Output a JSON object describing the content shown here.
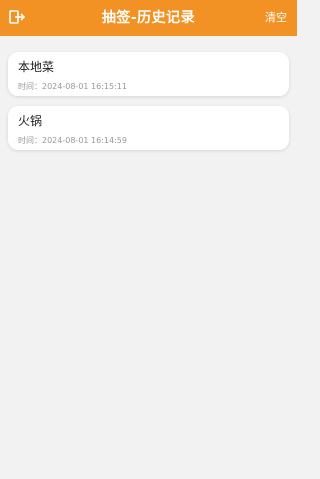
{
  "colors": {
    "accent": "#f39224",
    "background": "#f2f2f2",
    "card": "#ffffff",
    "time_text": "#999999"
  },
  "header": {
    "back_icon": "exit-door-icon",
    "title": "抽签-历史记录",
    "clear_label": "清空"
  },
  "records": [
    {
      "name": "本地菜",
      "time_label": "时间：",
      "time": "2024-08-01 16:15:11"
    },
    {
      "name": "火锅",
      "time_label": "时间：",
      "time": "2024-08-01 16:14:59"
    }
  ]
}
